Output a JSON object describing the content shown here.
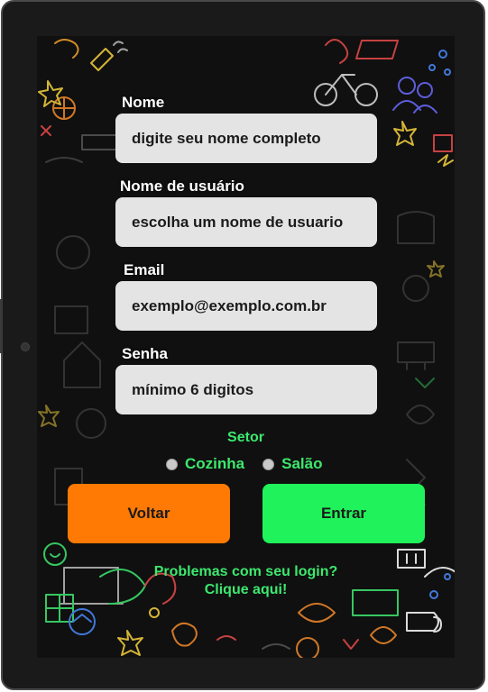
{
  "form": {
    "name_label": "Nome",
    "name_placeholder": "digite seu nome completo",
    "username_label": "Nome de usuário",
    "username_placeholder": "escolha um nome de usuario",
    "email_label": "Email",
    "email_placeholder": "exemplo@exemplo.com.br",
    "password_label": "Senha",
    "password_placeholder": "mínimo 6 digitos"
  },
  "sector": {
    "label": "Setor",
    "options": [
      "Cozinha",
      "Salão"
    ],
    "selected": null
  },
  "buttons": {
    "back_label": "Voltar",
    "enter_label": "Entrar"
  },
  "help": {
    "line1": "Problemas com seu login?",
    "line2": "Clique aqui!"
  },
  "colors": {
    "accent_green": "#3de86e",
    "enter_button": "#20f25b",
    "back_button": "#ff7a05",
    "field_background": "#e4e4e4",
    "screen_background": "#101010"
  }
}
